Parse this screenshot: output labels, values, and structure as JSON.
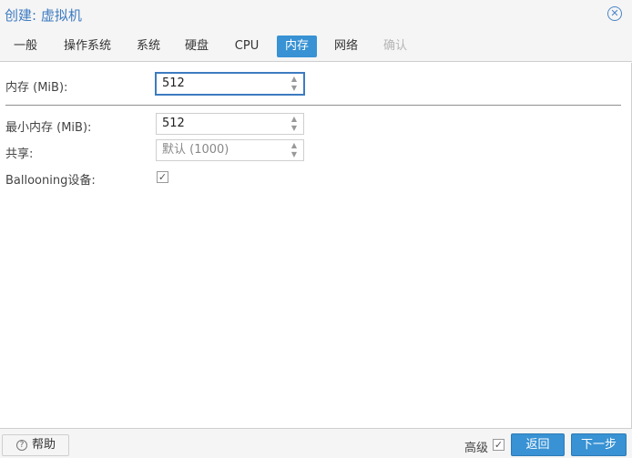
{
  "dialog": {
    "title": "创建: 虚拟机",
    "close_glyph": "✕"
  },
  "tabs": [
    {
      "label": "一般"
    },
    {
      "label": "操作系统"
    },
    {
      "label": "系统"
    },
    {
      "label": "硬盘"
    },
    {
      "label": "CPU"
    },
    {
      "label": "内存",
      "active": true
    },
    {
      "label": "网络"
    },
    {
      "label": "确认",
      "disabled": true
    }
  ],
  "memory": {
    "label": "内存 (MiB):",
    "value": "512",
    "min_label": "最小内存 (MiB):",
    "min_value": "512",
    "shares_label": "共享:",
    "shares_placeholder": "默认 (1000)",
    "ballooning_label": "Ballooning设备:",
    "ballooning_checked": true
  },
  "icons": {
    "spinner_up": "▲",
    "spinner_down": "▼",
    "checkmark": "✓",
    "help": "?"
  },
  "footer": {
    "help_label": "帮助",
    "advanced_label": "高级",
    "advanced_checked": true,
    "back_label": "返回",
    "next_label": "下一步"
  },
  "colors": {
    "accent": "#3892d4",
    "title": "#3d7bc0"
  }
}
